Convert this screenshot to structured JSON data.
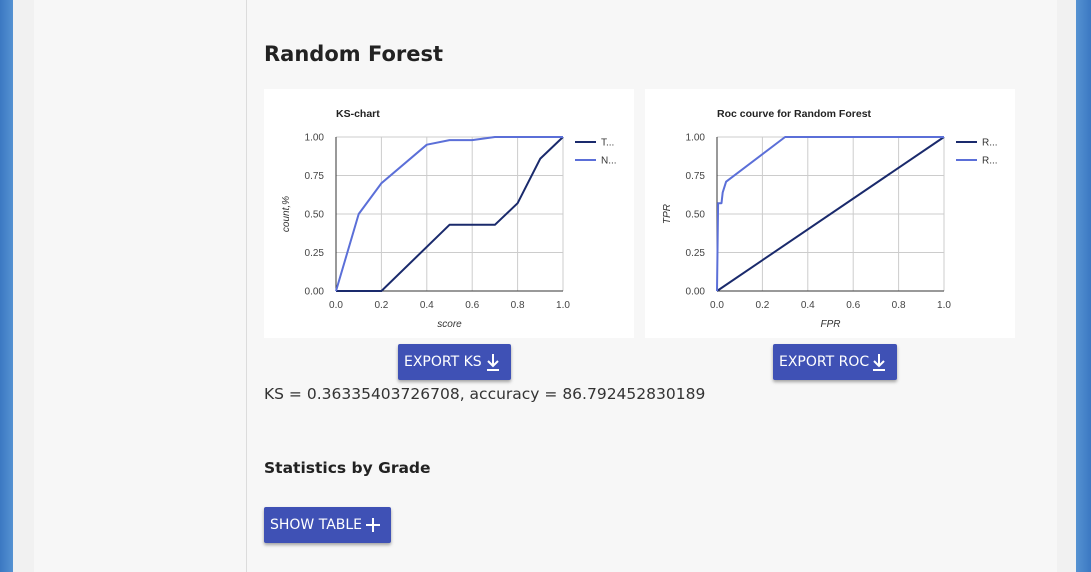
{
  "section": {
    "title": "Random Forest",
    "metrics_text": "KS = 0.36335403726708, accuracy = 86.792452830189",
    "stats_title": "Statistics by Grade"
  },
  "buttons": {
    "export_ks": "EXPORT KS",
    "export_roc": "EXPORT ROC",
    "show_table": "SHOW TABLE"
  },
  "icons": {
    "export_ks": "download-icon",
    "export_roc": "download-icon",
    "show_table": "plus-icon"
  },
  "colors": {
    "primary_button": "#3f51b5",
    "series_dark": "#1a2a6c",
    "series_light": "#5b6fd8"
  },
  "chart_data": [
    {
      "type": "line",
      "title": "KS-chart",
      "xlabel": "score",
      "ylabel": "count,%",
      "xlim": [
        0,
        1
      ],
      "ylim": [
        0,
        1
      ],
      "x_ticks": [
        "0.0",
        "0.2",
        "0.4",
        "0.6",
        "0.8",
        "1.0"
      ],
      "y_ticks": [
        "0.00",
        "0.25",
        "0.50",
        "0.75",
        "1.00"
      ],
      "grid": true,
      "legend_position": "right",
      "series": [
        {
          "name": "T...",
          "color": "#1a2a6c",
          "x": [
            0,
            0.2,
            0.5,
            0.6,
            0.7,
            0.8,
            0.9,
            1.0
          ],
          "y": [
            0,
            0,
            0.43,
            0.43,
            0.43,
            0.57,
            0.86,
            1.0
          ]
        },
        {
          "name": "N...",
          "color": "#5b6fd8",
          "x": [
            0,
            0.1,
            0.2,
            0.4,
            0.5,
            0.6,
            0.7,
            0.8,
            0.9,
            1.0
          ],
          "y": [
            0,
            0.5,
            0.7,
            0.95,
            0.98,
            0.98,
            1.0,
            1.0,
            1.0,
            1.0
          ]
        }
      ]
    },
    {
      "type": "line",
      "title": "Roc courve for Random Forest",
      "xlabel": "FPR",
      "ylabel": "TPR",
      "xlim": [
        0,
        1
      ],
      "ylim": [
        0,
        1
      ],
      "x_ticks": [
        "0.0",
        "0.2",
        "0.4",
        "0.6",
        "0.8",
        "1.0"
      ],
      "y_ticks": [
        "0.00",
        "0.25",
        "0.50",
        "0.75",
        "1.00"
      ],
      "grid": true,
      "legend_position": "right",
      "series": [
        {
          "name": "R...",
          "color": "#1a2a6c",
          "x": [
            0,
            1
          ],
          "y": [
            0,
            1
          ]
        },
        {
          "name": "R...",
          "color": "#5b6fd8",
          "x": [
            0,
            0.005,
            0.02,
            0.025,
            0.04,
            0.3,
            1.0
          ],
          "y": [
            0,
            0.57,
            0.57,
            0.64,
            0.71,
            1.0,
            1.0
          ]
        }
      ]
    }
  ]
}
